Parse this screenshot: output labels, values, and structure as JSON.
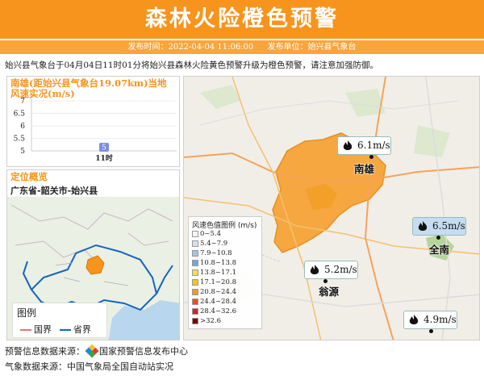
{
  "header": {
    "title": "森林火险橙色预警"
  },
  "subbar": {
    "publish_time": "发布时间：2022-04-04 11:06:00",
    "publisher": "发布单位：始兴县气象台"
  },
  "notice": "始兴县气象台于04月04日11时01分将始兴县森林火险黄色预警升级为橙色预警，请注意加强防御。",
  "wind_panel": {
    "title": "南雄(距始兴县气象台19.07km)当地风速实况(m/s)"
  },
  "chart_data": {
    "type": "bar",
    "categories": [
      "11时"
    ],
    "values": [
      5
    ],
    "data_labels": [
      "5"
    ],
    "yticks": [
      "7",
      "6.5",
      "6",
      "5.5",
      "5"
    ],
    "ylim": [
      5,
      7
    ]
  },
  "location": {
    "title": "定位概览",
    "text": "广东省-韶关市-始兴县"
  },
  "legend": {
    "title": "图例",
    "items": [
      {
        "label": "国界",
        "color": "#e57373"
      },
      {
        "label": "省界",
        "color": "#1565c0"
      }
    ]
  },
  "scale": {
    "title": "风速色值图例 (m/s)",
    "rows": [
      {
        "label": "0~5.4",
        "color": "#f5f5f5"
      },
      {
        "label": "5.4~7.9",
        "color": "#cfe2f3"
      },
      {
        "label": "7.9~10.8",
        "color": "#9fc5e8"
      },
      {
        "label": "10.8~13.8",
        "color": "#6fa8dc"
      },
      {
        "label": "13.8~17.1",
        "color": "#f1e04c"
      },
      {
        "label": "17.1~20.8",
        "color": "#f5c518"
      },
      {
        "label": "20.8~24.4",
        "color": "#f29b1d"
      },
      {
        "label": "24.4~28.4",
        "color": "#e8501a"
      },
      {
        "label": "28.4~32.6",
        "color": "#c62828"
      },
      {
        "label": ">32.6",
        "color": "#7f0000"
      }
    ]
  },
  "stations": [
    {
      "city": "南雄",
      "value": "6.1m/s"
    },
    {
      "city": "全南",
      "value": "6.5m/s"
    },
    {
      "city": "翁源",
      "value": "5.2m/s"
    },
    {
      "city": "",
      "value": "4.9m/s"
    }
  ],
  "footer": {
    "source_label": "预警信息数据来源：",
    "source_name": "国家预警信息发布中心",
    "weather_source": "气象数据来源：中国气象局全国自动站实况"
  }
}
